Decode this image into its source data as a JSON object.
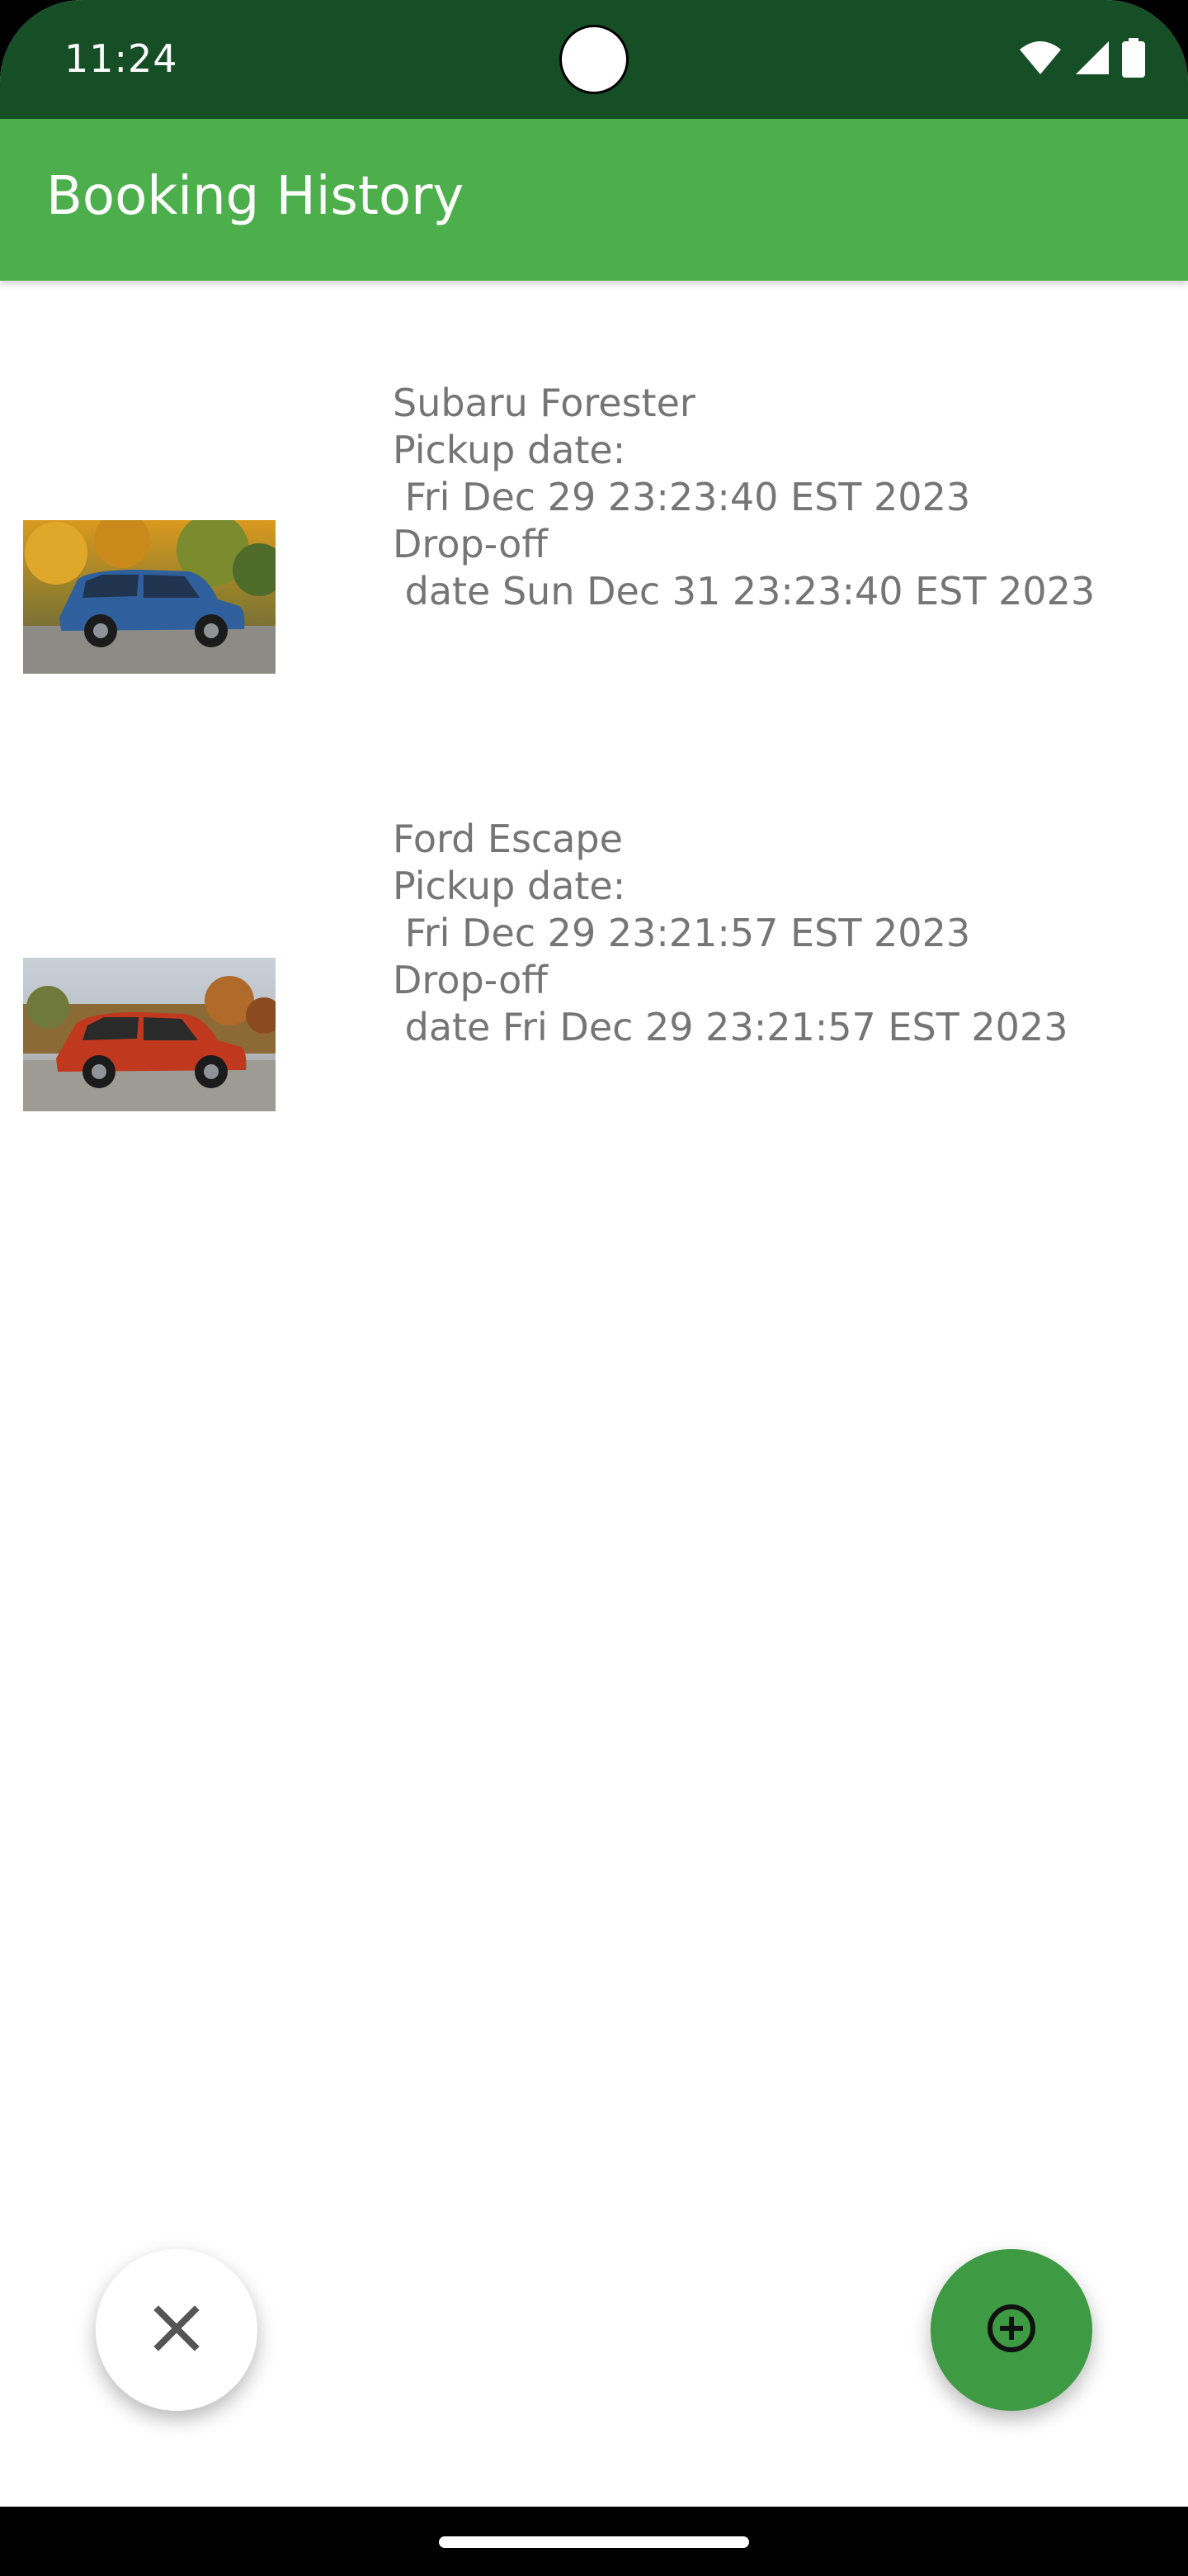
{
  "status_bar": {
    "time": "11:24",
    "icons": [
      "wifi-icon",
      "signal-icon",
      "battery-icon"
    ]
  },
  "app_bar": {
    "title": "Booking History"
  },
  "bookings": [
    {
      "car_name": "Subaru Forester",
      "text": "Subaru Forester\nPickup date:\n Fri Dec 29 23:23:40 EST 2023\nDrop-off\n date Sun Dec 31 23:23:40 EST 2023",
      "image_icon": "blue-suv-photo"
    },
    {
      "car_name": "Ford Escape",
      "text": "Ford Escape\nPickup date:\n Fri Dec 29 23:21:57 EST 2023\nDrop-off\n date Fri Dec 29 23:21:57 EST 2023",
      "image_icon": "red-suv-photo"
    }
  ],
  "fabs": {
    "cancel_icon": "close-icon",
    "add_icon": "add-circle-icon"
  },
  "colors": {
    "status_bar": "#164f26",
    "app_bar": "#4caf4b",
    "fab_add": "#3f9a44",
    "body_text": "#757575"
  }
}
